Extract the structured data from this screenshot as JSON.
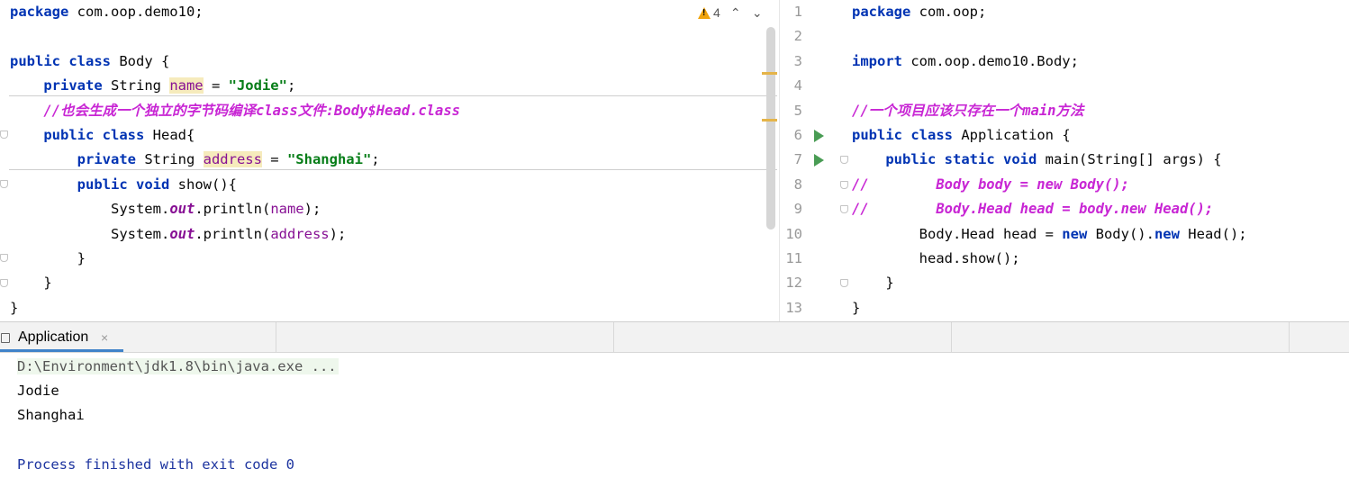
{
  "left_editor": {
    "inspection": {
      "warning_count": "4",
      "prev_label": "⌃",
      "next_label": "⌄"
    },
    "lines": [
      {
        "tokens": [
          {
            "t": "package",
            "c": "kw"
          },
          {
            "t": " com.oop.demo10;"
          }
        ]
      },
      {
        "tokens": []
      },
      {
        "tokens": [
          {
            "t": "public",
            "c": "kw"
          },
          {
            "t": " "
          },
          {
            "t": "class",
            "c": "kw"
          },
          {
            "t": " Body {"
          }
        ]
      },
      {
        "tokens": [
          {
            "t": "    "
          },
          {
            "t": "private",
            "c": "kw"
          },
          {
            "t": " String "
          },
          {
            "t": "name",
            "c": "fld hl"
          },
          {
            "t": " = "
          },
          {
            "t": "\"Jodie\"",
            "c": "str"
          },
          {
            "t": ";"
          }
        ]
      },
      {
        "tokens": [
          {
            "t": "    "
          },
          {
            "t": "//",
            "c": "cmt"
          },
          {
            "t": "也会生成一个独立的字节码编译",
            "c": "cmtc"
          },
          {
            "t": "class",
            "c": "cmt"
          },
          {
            "t": "文件",
            "c": "cmtc"
          },
          {
            "t": ":Body$Head.class",
            "c": "cmt"
          }
        ]
      },
      {
        "tokens": [
          {
            "t": "    "
          },
          {
            "t": "public",
            "c": "kw"
          },
          {
            "t": " "
          },
          {
            "t": "class",
            "c": "kw"
          },
          {
            "t": " Head{"
          }
        ]
      },
      {
        "tokens": [
          {
            "t": "        "
          },
          {
            "t": "private",
            "c": "kw"
          },
          {
            "t": " String "
          },
          {
            "t": "address",
            "c": "fld hl"
          },
          {
            "t": " = "
          },
          {
            "t": "\"Shanghai\"",
            "c": "str"
          },
          {
            "t": ";"
          }
        ]
      },
      {
        "tokens": [
          {
            "t": "        "
          },
          {
            "t": "public",
            "c": "kw"
          },
          {
            "t": " "
          },
          {
            "t": "void",
            "c": "kw"
          },
          {
            "t": " show(){"
          }
        ]
      },
      {
        "tokens": [
          {
            "t": "            System."
          },
          {
            "t": "out",
            "c": "static"
          },
          {
            "t": ".println("
          },
          {
            "t": "name",
            "c": "fld"
          },
          {
            "t": ");"
          }
        ]
      },
      {
        "tokens": [
          {
            "t": "            System."
          },
          {
            "t": "out",
            "c": "static"
          },
          {
            "t": ".println("
          },
          {
            "t": "address",
            "c": "fld"
          },
          {
            "t": ");"
          }
        ]
      },
      {
        "tokens": [
          {
            "t": "        }"
          }
        ]
      },
      {
        "tokens": [
          {
            "t": "    }"
          }
        ]
      },
      {
        "tokens": [
          {
            "t": "}"
          }
        ]
      }
    ]
  },
  "right_editor": {
    "line_numbers": [
      "1",
      "2",
      "3",
      "4",
      "5",
      "6",
      "7",
      "8",
      "9",
      "10",
      "11",
      "12",
      "13"
    ],
    "lines": [
      {
        "tokens": [
          {
            "t": "package",
            "c": "kw"
          },
          {
            "t": " com.oop;"
          }
        ]
      },
      {
        "tokens": []
      },
      {
        "tokens": [
          {
            "t": "import",
            "c": "kw"
          },
          {
            "t": " com.oop.demo10.Body;"
          }
        ]
      },
      {
        "tokens": []
      },
      {
        "tokens": [
          {
            "t": "//",
            "c": "cmt"
          },
          {
            "t": "一个项目应该只存在一个",
            "c": "cmtc"
          },
          {
            "t": "main",
            "c": "cmt"
          },
          {
            "t": "方法",
            "c": "cmtc"
          }
        ]
      },
      {
        "tokens": [
          {
            "t": "public",
            "c": "kw"
          },
          {
            "t": " "
          },
          {
            "t": "class",
            "c": "kw"
          },
          {
            "t": " Application {"
          }
        ]
      },
      {
        "tokens": [
          {
            "t": "    "
          },
          {
            "t": "public",
            "c": "kw"
          },
          {
            "t": " "
          },
          {
            "t": "static",
            "c": "kw"
          },
          {
            "t": " "
          },
          {
            "t": "void",
            "c": "kw"
          },
          {
            "t": " main(String[] args) {"
          }
        ]
      },
      {
        "tokens": [
          {
            "t": "//        Body body = new Body();",
            "c": "cmt"
          }
        ]
      },
      {
        "tokens": [
          {
            "t": "//        Body.Head head = body.new Head();",
            "c": "cmt"
          }
        ]
      },
      {
        "tokens": [
          {
            "t": "        Body.Head head = "
          },
          {
            "t": "new",
            "c": "kw"
          },
          {
            "t": " Body()."
          },
          {
            "t": "new",
            "c": "kw"
          },
          {
            "t": " Head();"
          }
        ]
      },
      {
        "tokens": [
          {
            "t": "        head.show();"
          }
        ]
      },
      {
        "tokens": [
          {
            "t": "    }"
          }
        ]
      },
      {
        "tokens": [
          {
            "t": "}"
          }
        ]
      }
    ]
  },
  "console": {
    "tab_label": "Application",
    "tab_close": "×",
    "command": "D:\\Environment\\jdk1.8\\bin\\java.exe ...",
    "output": [
      "Jodie",
      "Shanghai"
    ],
    "exit_message": "Process finished with exit code 0"
  }
}
